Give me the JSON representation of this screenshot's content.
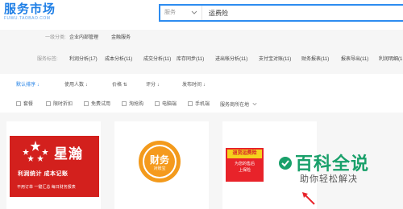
{
  "header": {
    "logo_main": "服务市场",
    "logo_sub": "FUWU.TAOBAO.COM",
    "search_category": "服务",
    "search_value": "运费险"
  },
  "filters": {
    "category_label": "一级分类:",
    "categories": [
      "企业内部管理",
      "金融服务"
    ],
    "tag_label": "服务标签:",
    "tags": [
      "利润分析(17)",
      "成本分析(11)",
      "成交分析(11)",
      "库存同步(11)",
      "进出帐分析(11)",
      "支付宝对账(11)",
      "财务报表(11)",
      "报表导出(11)",
      "利润明细(1"
    ]
  },
  "sort_bar": {
    "items": [
      {
        "label": "默认排序",
        "arrow": "↓"
      },
      {
        "label": "使用人数",
        "arrow": "↓"
      },
      {
        "label": "价格",
        "arrow": "⇅"
      },
      {
        "label": "评分",
        "arrow": "↓"
      },
      {
        "label": "发布时间",
        "arrow": "↓"
      }
    ]
  },
  "checkboxes": [
    "套餐",
    "限时折扣",
    "免费试用",
    "淘抢购",
    "电脑端",
    "手机端",
    "服务商所在地"
  ],
  "cards": {
    "c1": {
      "name": "星瀚",
      "line1": "利润统计 成本记账",
      "line2": "不用订单 一键汇总 每日财务报表"
    },
    "c2": {
      "name": "财务",
      "sub": "对账宝"
    },
    "c3": {
      "title": "退货运费险",
      "sub1": "为您的售后",
      "sub2": "上保险"
    }
  },
  "watermark": {
    "title": "百科全说",
    "sub": "助你轻松解决"
  },
  "colors": {
    "accent": "#1f7fe6",
    "brand_red": "#d3201d",
    "orange": "#f59a1d",
    "green": "#19a06a"
  }
}
